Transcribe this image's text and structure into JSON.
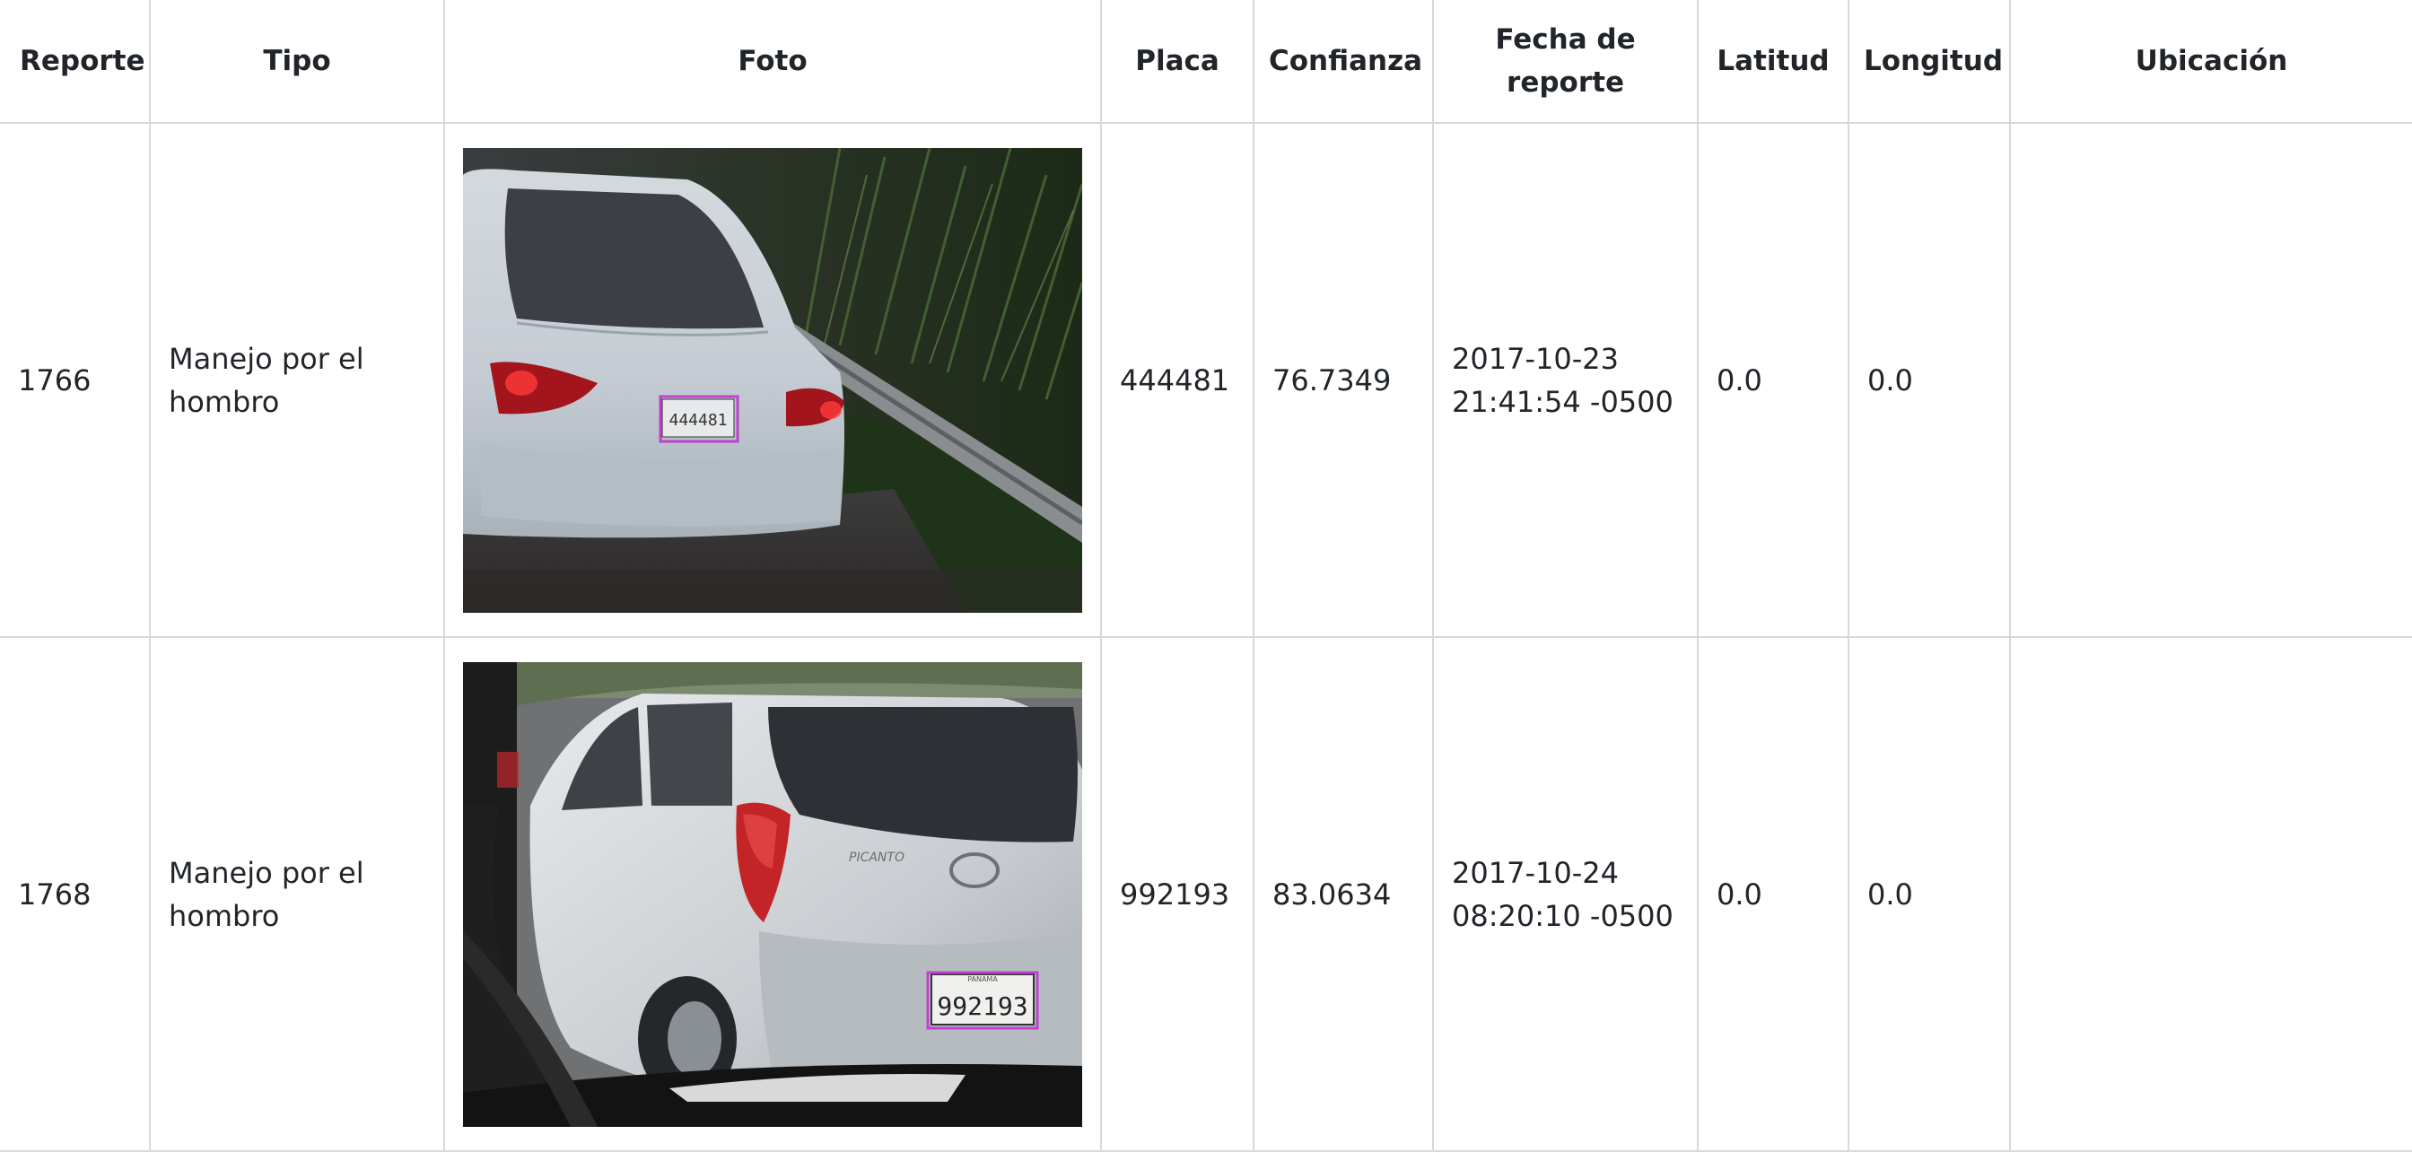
{
  "table": {
    "headers": {
      "reporte": "Reporte",
      "tipo": "Tipo",
      "foto": "Foto",
      "placa": "Placa",
      "confianza": "Confianza",
      "fecha_line1": "Fecha de",
      "fecha_line2": "reporte",
      "latitud": "Latitud",
      "longitud": "Longitud",
      "ubicacion": "Ubicación"
    },
    "rows": [
      {
        "reporte": "1766",
        "tipo": "Manejo por el hombro",
        "photo_plate_text": "444481",
        "placa": "444481",
        "confianza": "76.7349",
        "fecha_date": "2017-10-23",
        "fecha_time": "21:41:54 -0500",
        "latitud": "0.0",
        "longitud": "0.0",
        "ubicacion": ""
      },
      {
        "reporte": "1768",
        "tipo": "Manejo por el hombro",
        "photo_plate_text": "992193",
        "photo_plate_caption": "PANAMÁ",
        "photo_badge": "PICANTO",
        "placa": "992193",
        "confianza": "83.0634",
        "fecha_date": "2017-10-24",
        "fecha_time": "08:20:10 -0500",
        "latitud": "0.0",
        "longitud": "0.0",
        "ubicacion": ""
      }
    ]
  },
  "colors": {
    "plate_box": "#c040d0",
    "border": "#d8d8d8"
  }
}
